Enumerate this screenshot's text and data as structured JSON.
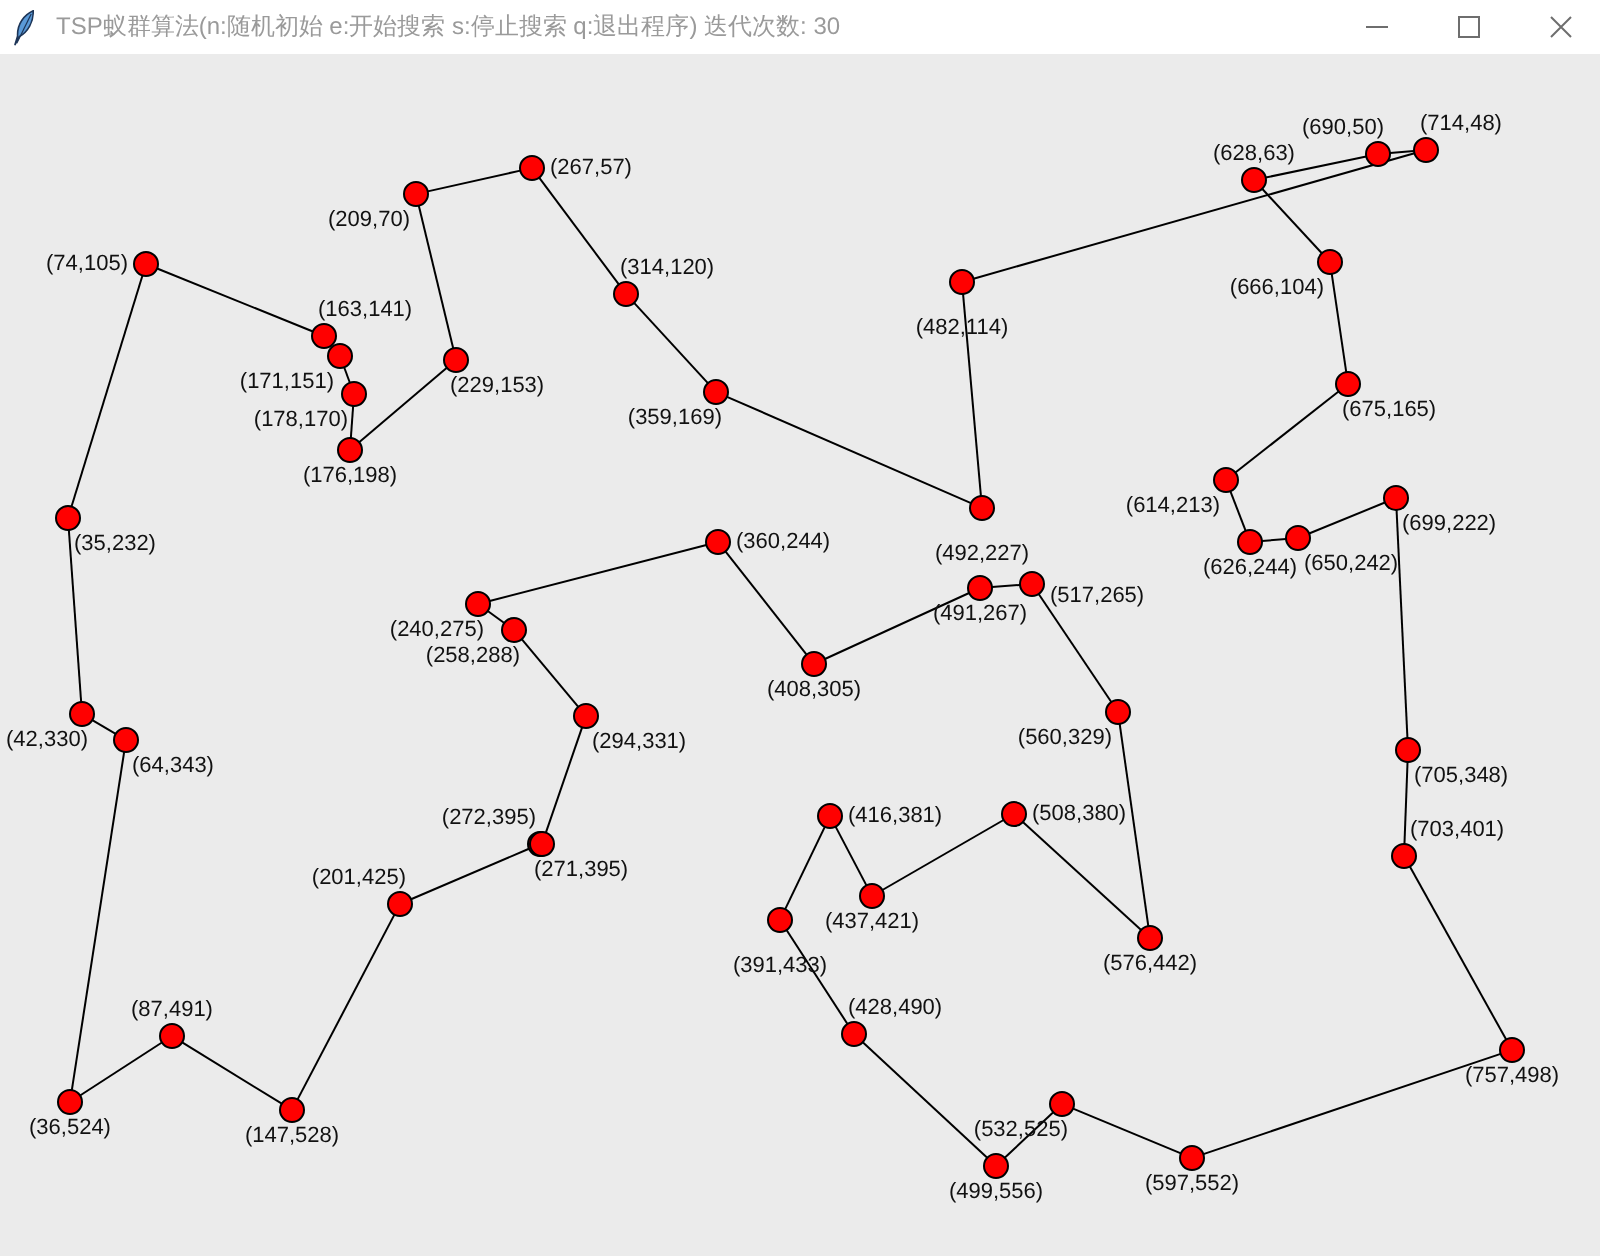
{
  "window": {
    "title": "TSP蚁群算法(n:随机初始 e:开始搜索 s:停止搜索 q:退出程序) 迭代次数: 30"
  },
  "route": {
    "points": [
      {
        "label": "(690,50)"
      },
      {
        "label": "(714,48)"
      },
      {
        "label": "(267,57)"
      },
      {
        "label": "(628,63)"
      },
      {
        "label": "(209,70)"
      },
      {
        "label": "(74,105)"
      },
      {
        "label": "(666,104)"
      },
      {
        "label": "(482,114)"
      },
      {
        "label": "(314,120)"
      },
      {
        "label": "(163,141)"
      },
      {
        "label": "(171,151)"
      },
      {
        "label": "(229,153)"
      },
      {
        "label": "(178,170)"
      },
      {
        "label": "(359,169)"
      },
      {
        "label": "(675,165)"
      },
      {
        "label": "(176,198)"
      },
      {
        "label": "(614,213)"
      },
      {
        "label": "(699,222)"
      },
      {
        "label": "(492,227)"
      },
      {
        "label": "(35,232)"
      },
      {
        "label": "(360,244)"
      },
      {
        "label": "(626,244)"
      },
      {
        "label": "(650,242)"
      },
      {
        "label": "(491,267)"
      },
      {
        "label": "(517,265)"
      },
      {
        "label": "(240,275)"
      },
      {
        "label": "(258,288)"
      },
      {
        "label": "(408,305)"
      },
      {
        "label": "(42,330)"
      },
      {
        "label": "(294,331)"
      },
      {
        "label": "(560,329)"
      },
      {
        "label": "(64,343)"
      },
      {
        "label": "(705,348)"
      },
      {
        "label": "(416,381)"
      },
      {
        "label": "(508,380)"
      },
      {
        "label": "(271,395)"
      },
      {
        "label": "(272,395)"
      },
      {
        "label": "(703,401)"
      },
      {
        "label": "(201,425)"
      },
      {
        "label": "(437,421)"
      },
      {
        "label": "(391,433)"
      },
      {
        "label": "(576,442)"
      },
      {
        "label": "(87,491)"
      },
      {
        "label": "(428,490)"
      },
      {
        "label": "(757,498)"
      },
      {
        "label": "(36,524)"
      },
      {
        "label": "(147,528)"
      },
      {
        "label": "(532,525)"
      },
      {
        "label": "(499,556)"
      },
      {
        "label": "(597,552)"
      }
    ]
  }
}
